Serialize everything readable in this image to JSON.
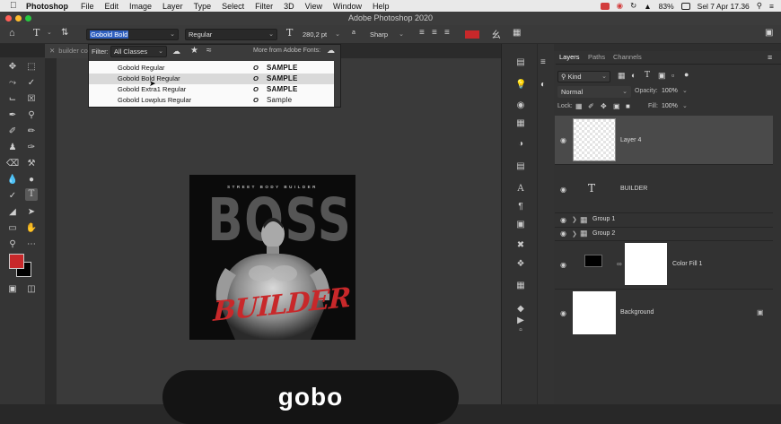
{
  "menubar": {
    "app": "Photoshop",
    "items": [
      "File",
      "Edit",
      "Image",
      "Layer",
      "Type",
      "Select",
      "Filter",
      "3D",
      "View",
      "Window",
      "Help"
    ],
    "battery": "83%",
    "datetime": "Sel 7 Apr  17.36"
  },
  "window_title": "Adobe Photoshop 2020",
  "options": {
    "font_family": "Gobold Bold",
    "font_style": "Regular",
    "font_size": "280,2 pt",
    "antialias": "Sharp",
    "color": "#c8282a"
  },
  "font_popup": {
    "filter_label": "Filter:",
    "filter_value": "All Classes",
    "more_fonts": "More from Adobe Fonts:",
    "fonts": [
      {
        "name": "Gobold Regular",
        "icon": "O",
        "sample": "SAMPLE"
      },
      {
        "name": "Gobold Bold Regular",
        "icon": "O",
        "sample": "SAMPLE"
      },
      {
        "name": "Gobold Extra1 Regular",
        "icon": "O",
        "sample": "SAMPLE"
      },
      {
        "name": "Gobold Lowplus Regular",
        "icon": "O",
        "sample": "Sample"
      }
    ]
  },
  "doc_tab": "builder co",
  "artwork": {
    "subtitle": "STREET BODY BUILDER",
    "headline": "BOSS",
    "script": "BUILDER"
  },
  "panels": {
    "tabs": [
      "Layers",
      "Paths",
      "Channels"
    ],
    "kind": "Kind",
    "blend": "Normal",
    "opacity_label": "Opacity:",
    "opacity": "100%",
    "lock_label": "Lock:",
    "fill_label": "Fill:",
    "fill": "100%",
    "layers": [
      "Layer 4",
      "BUILDER",
      "Group 1",
      "Group 2",
      "Color Fill 1",
      "Background"
    ]
  },
  "overlay_text": "gobo",
  "colors": {
    "foreground": "#c8282a",
    "background": "#000000"
  }
}
